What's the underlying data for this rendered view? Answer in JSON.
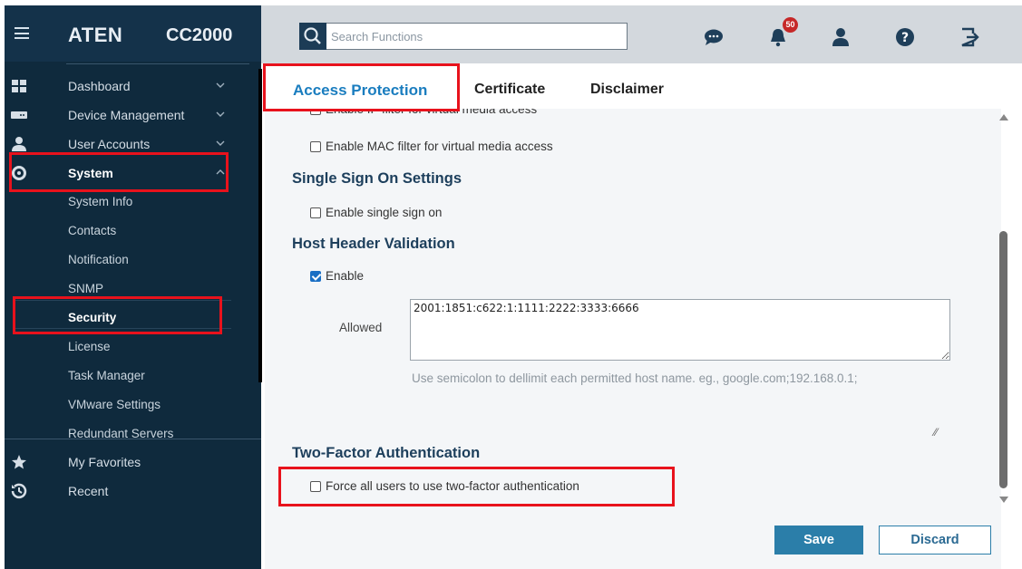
{
  "app": {
    "brand": "ATEN",
    "product": "CC2000"
  },
  "search": {
    "placeholder": "Search Functions",
    "value": ""
  },
  "toolbar": {
    "icons": [
      "chat-icon",
      "bell-icon",
      "user-icon",
      "help-icon",
      "logout-icon"
    ],
    "notification_count": "50"
  },
  "sidebar": {
    "items": [
      {
        "label": "Dashboard",
        "icon": "dashboard-icon"
      },
      {
        "label": "Device Management",
        "icon": "device-icon"
      },
      {
        "label": "User Accounts",
        "icon": "user-accounts-icon"
      },
      {
        "label": "System",
        "icon": "gear-icon"
      }
    ],
    "system_sub": [
      {
        "label": "System Info"
      },
      {
        "label": "Contacts"
      },
      {
        "label": "Notification"
      },
      {
        "label": "SNMP"
      },
      {
        "label": "Security"
      },
      {
        "label": "License"
      },
      {
        "label": "Task Manager"
      },
      {
        "label": "VMware Settings"
      },
      {
        "label": "Redundant Servers"
      }
    ],
    "bottom": [
      {
        "label": "My Favorites",
        "icon": "star-icon"
      },
      {
        "label": "Recent",
        "icon": "history-icon"
      }
    ]
  },
  "tabs": [
    {
      "label": "Access Protection",
      "active": true
    },
    {
      "label": "Certificate",
      "active": false
    },
    {
      "label": "Disclaimer",
      "active": false
    }
  ],
  "content": {
    "clipped_option": "Enable IP filter for virtual media access",
    "mac_filter": "Enable MAC filter for virtual media access",
    "sso_title": "Single Sign On Settings",
    "sso_option": "Enable single sign on",
    "host_title": "Host Header Validation",
    "host_enable": "Enable",
    "allowed_label": "Allowed",
    "allowed_value": "2001:1851:c622:1:1111:2222:3333:6666",
    "allowed_hint": "Use semicolon to dellimit each permitted host name. eg., google.com;192.168.0.1;",
    "tfa_title": "Two-Factor Authentication",
    "tfa_option": "Force all users to use two-factor authentication"
  },
  "actions": {
    "save": "Save",
    "discard": "Discard"
  },
  "colors": {
    "sidebar_bg": "#0f2a3d",
    "accent": "#1a7dbf",
    "annotation": "#e8121c"
  }
}
